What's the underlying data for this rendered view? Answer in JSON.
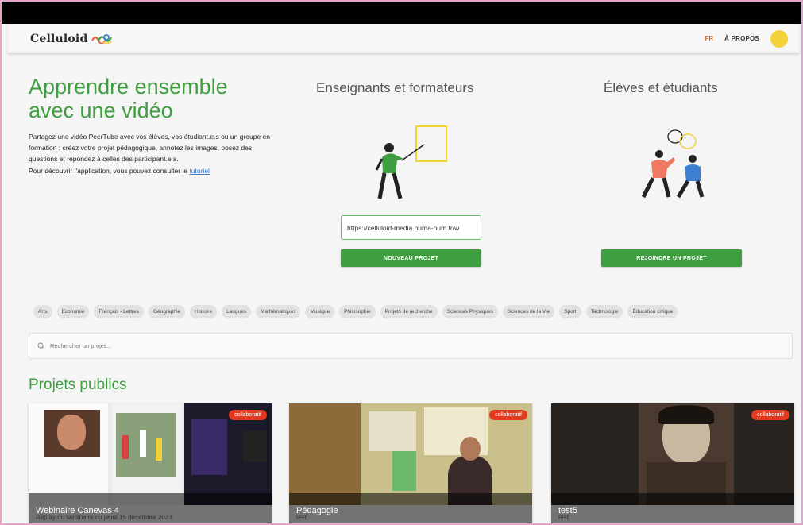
{
  "header": {
    "brand": "Celluloid",
    "lang": "FR",
    "about": "À PROPOS",
    "avatar_initial": "Ⅱ"
  },
  "hero": {
    "title_line1": "Apprendre ensemble",
    "title_line2": "avec une vidéo",
    "paragraph": "Partagez une vidéo PeerTube avec vos élèves, vos étudiant.e.s ou un groupe en formation : créez votre projet pédagogique, annotez les images, posez des questions et répondez à celles des participant.e.s.",
    "tutorial_prefix": "Pour découvrir l'application, vous pouvez consulter le ",
    "tutorial_link": "tutoriel"
  },
  "teachers": {
    "title": "Enseignants et formateurs",
    "url_value": "https://celluloid-media.huma-num.fr/w",
    "button": "NOUVEAU PROJET"
  },
  "students": {
    "title": "Élèves et étudiants",
    "button": "REJOINDRE UN PROJET"
  },
  "categories": [
    "Arts",
    "Economie",
    "Français - Lettres",
    "Géographie",
    "Histoire",
    "Langues",
    "Mathématiques",
    "Musique",
    "Philosophie",
    "Projets de recherche",
    "Sciences Physiques",
    "Sciences de la Vie",
    "Sport",
    "Technologie",
    "Éducation civique"
  ],
  "search": {
    "placeholder": "Rechercher un projet..."
  },
  "projects": {
    "title": "Projets publics",
    "items": [
      {
        "title": "Webinaire Canevas 4",
        "badge": "collaboratif",
        "description": "Replay du webinaire du jeudi 15 décembre 2023"
      },
      {
        "title": "Pédagogie",
        "badge": "collaboratif",
        "description": "test"
      },
      {
        "title": "test5",
        "badge": "collaboratif",
        "description": "test"
      }
    ]
  },
  "colors": {
    "green": "#3f9e3f",
    "badge_red": "#e23a1e",
    "avatar_yellow": "#f3d23a",
    "lang_orange": "#e06a3a"
  }
}
